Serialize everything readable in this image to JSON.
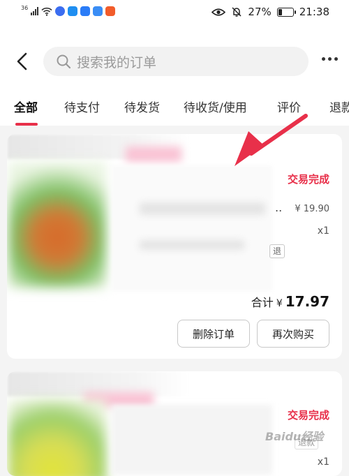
{
  "status_bar": {
    "signal_label": "36",
    "battery_percent": "27%",
    "time": "21:38",
    "battery_level": 0.27
  },
  "header": {
    "search_placeholder": "搜索我的订单"
  },
  "tabs": [
    {
      "label": "全部",
      "active": true
    },
    {
      "label": "待支付"
    },
    {
      "label": "待发货"
    },
    {
      "label": "待收货/使用"
    },
    {
      "label": "评价"
    },
    {
      "label": "退款"
    }
  ],
  "orders": [
    {
      "status": "交易完成",
      "price": "¥ 19.90",
      "quantity": "x1",
      "tag": "退",
      "total_label": "合计",
      "total_currency": "¥",
      "total_amount": "17.97",
      "actions": [
        "删除订单",
        "再次购买"
      ]
    },
    {
      "status": "交易完成",
      "tag": "退款",
      "quantity": "x1"
    }
  ],
  "watermark": "Baidu经验",
  "colors": {
    "accent": "#e8304a",
    "background": "#f4f4f4",
    "card": "#ffffff"
  }
}
